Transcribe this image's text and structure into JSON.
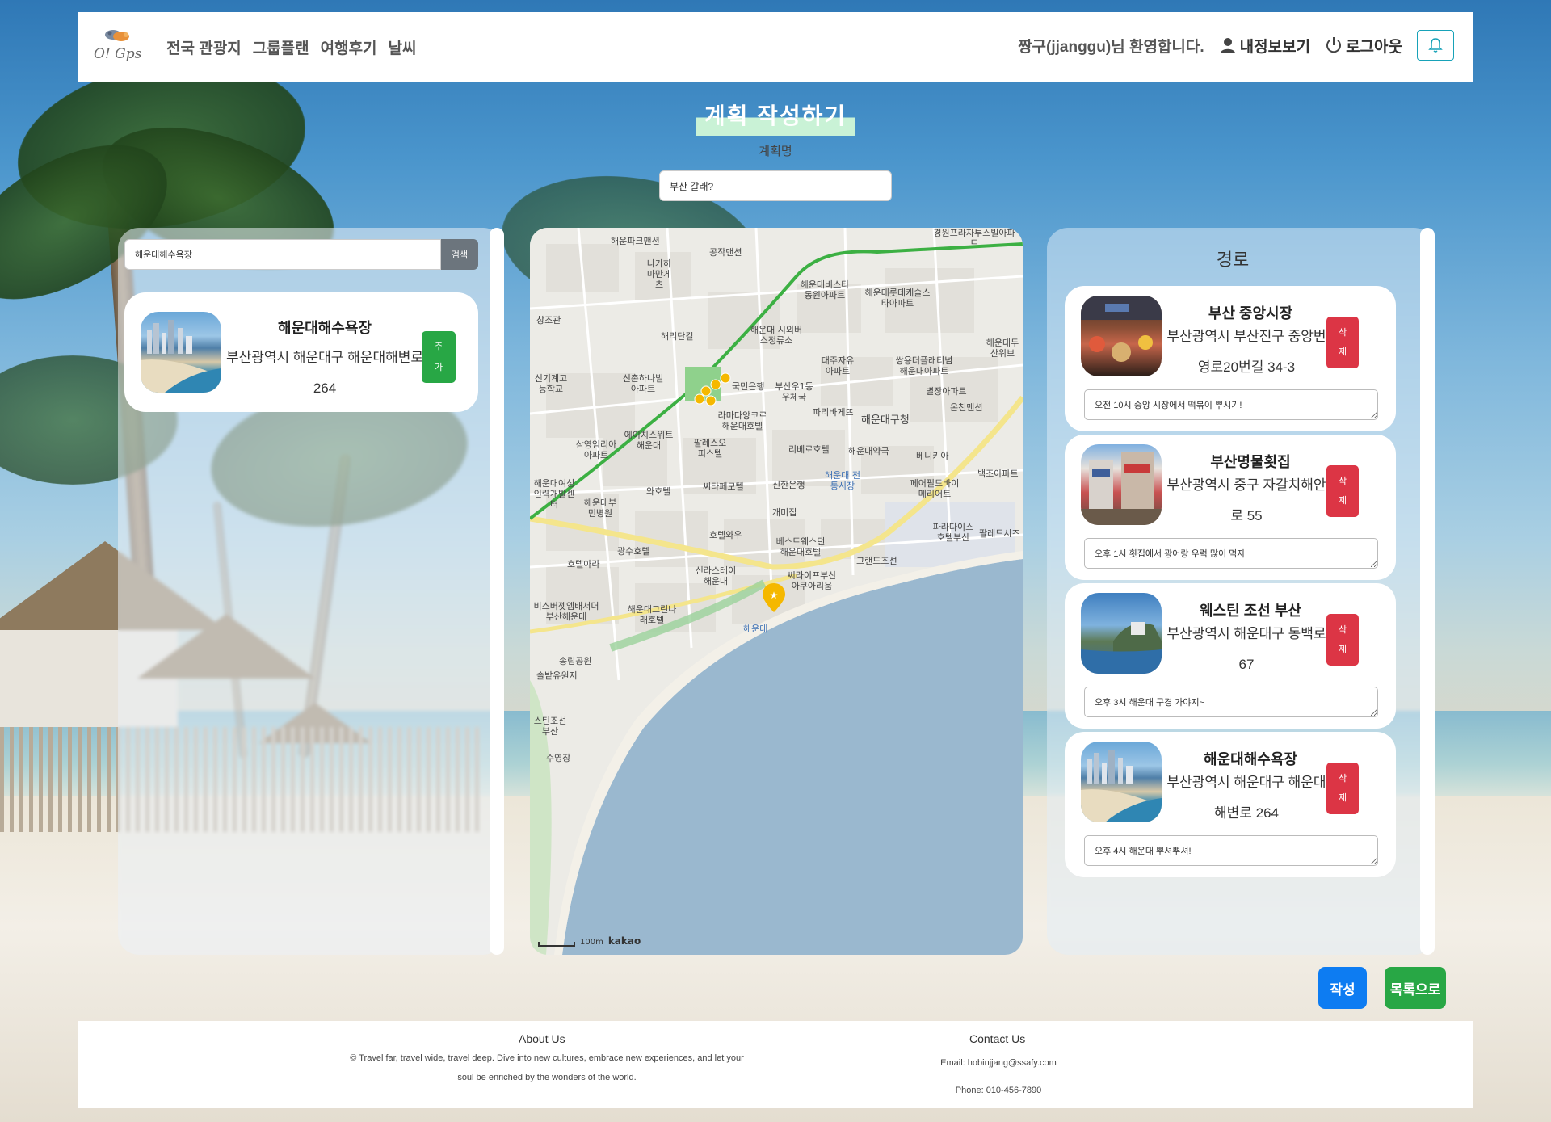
{
  "brand": {
    "logo_text": "O! Gps"
  },
  "nav": {
    "links": [
      "전국 관광지",
      "그룹플랜",
      "여행후기",
      "날씨"
    ],
    "welcome": "짱구(jjanggu)님 환영합니다.",
    "my_info": "내정보보기",
    "logout": "로그아웃"
  },
  "plan": {
    "title": "계획 작성하기",
    "name_label": "계획명",
    "name_value": "부산 갈래?"
  },
  "search": {
    "value": "해운대해수욕장",
    "button": "검색",
    "results": [
      {
        "name": "해운대해수욕장",
        "address": "부산광역시 해운대구 해운대해변로 264",
        "add_label": "추가"
      }
    ]
  },
  "map": {
    "labels": [
      "해운파크맨션",
      "공작맨션",
      "경원프라자투스빌아파트",
      "나가하마만게츠",
      "해운대비스타동원아파트",
      "해운대롯데캐슬스타아파트",
      "창조관",
      "해리단길",
      "해운대 시외버스정류소",
      "해운대두산위브",
      "신기계고등학교",
      "신촌하나빌아파트",
      "대주자유아파트",
      "쌍용더플래티넘해운대아파트",
      "국민은행",
      "부산우1동우체국",
      "별장아파트",
      "라마다앙코르해운대호텔",
      "파리바게뜨",
      "해운대구청",
      "온천맨션",
      "삼영임리아아파트",
      "에이치스위트해운대",
      "팔레스오피스텔",
      "리베로호텔",
      "해운대약국",
      "베니키아",
      "해운대여성인력개발센터",
      "와호텔",
      "씨타페모텔",
      "신한은행",
      "해운대 전통시장",
      "해운대부민병원",
      "개미집",
      "페어필드바이메리어트",
      "백조아파트",
      "호텔와우",
      "베스트웨스턴해운대호텔",
      "파라다이스호텔부산",
      "팔레드시즈",
      "광수호텔",
      "신라스테이해운대",
      "씨라이프부산아쿠아리움",
      "그랜드조선",
      "호텔아라",
      "비스버젯엠배서더부산해운대",
      "해운대그린나래호텔",
      "해운대",
      "송림공원",
      "솔밭유원지",
      "스틴조선부산",
      "수영장"
    ],
    "scale_label": "100m",
    "provider": "kakao"
  },
  "route": {
    "title": "경로",
    "delete_label": "삭제",
    "items": [
      {
        "name": "부산 중앙시장",
        "address": "부산광역시 부산진구 중앙번영로20번길 34-3",
        "memo": "오전 10시 중앙 시장에서 떡볶이 뿌시기!"
      },
      {
        "name": "부산명물횟집",
        "address": "부산광역시 중구 자갈치해안로 55",
        "memo": "오후 1시 횟집에서 광어랑 우럭 많이 먹자"
      },
      {
        "name": "웨스틴 조선 부산",
        "address": "부산광역시 해운대구 동백로 67",
        "memo": "오후 3시 해운대 구경 가야지~"
      },
      {
        "name": "해운대해수욕장",
        "address": "부산광역시 해운대구 해운대해변로 264",
        "memo": "오후 4시 해운대 뿌셔뿌셔!"
      }
    ]
  },
  "actions": {
    "write": "작성",
    "back_to_list": "목록으로"
  },
  "footer": {
    "about_title": "About Us",
    "about_text": "Travel far, travel wide, travel deep. Dive into new cultures, embrace new experiences, and let your soul be enriched by the wonders of the world.",
    "copyright_symbol": "©",
    "contact_title": "Contact Us",
    "email": "Email: hobinjjang@ssafy.com",
    "phone": "Phone: 010-456-7890"
  },
  "colors": {
    "primary": "#0d7cf2",
    "success": "#28a745",
    "danger": "#dc3545",
    "info": "#17a2b8",
    "route_line": "#3cb043",
    "marker": "#f5b800"
  }
}
